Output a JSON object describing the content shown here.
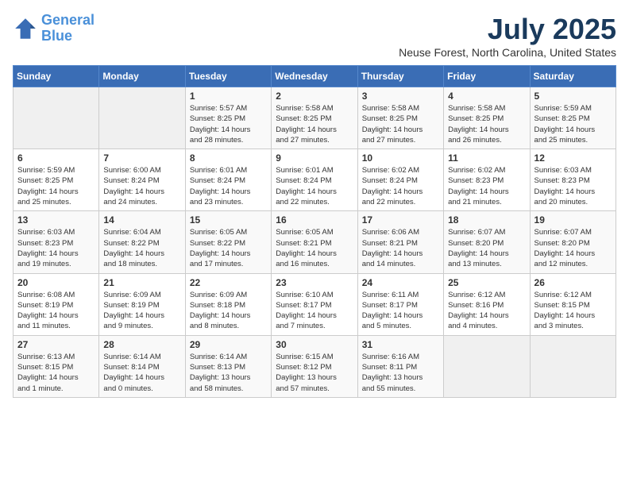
{
  "header": {
    "logo": {
      "line1": "General",
      "line2": "Blue"
    },
    "month": "July 2025",
    "location": "Neuse Forest, North Carolina, United States"
  },
  "weekdays": [
    "Sunday",
    "Monday",
    "Tuesday",
    "Wednesday",
    "Thursday",
    "Friday",
    "Saturday"
  ],
  "weeks": [
    [
      {
        "day": "",
        "info": ""
      },
      {
        "day": "",
        "info": ""
      },
      {
        "day": "1",
        "info": "Sunrise: 5:57 AM\nSunset: 8:25 PM\nDaylight: 14 hours\nand 28 minutes."
      },
      {
        "day": "2",
        "info": "Sunrise: 5:58 AM\nSunset: 8:25 PM\nDaylight: 14 hours\nand 27 minutes."
      },
      {
        "day": "3",
        "info": "Sunrise: 5:58 AM\nSunset: 8:25 PM\nDaylight: 14 hours\nand 27 minutes."
      },
      {
        "day": "4",
        "info": "Sunrise: 5:58 AM\nSunset: 8:25 PM\nDaylight: 14 hours\nand 26 minutes."
      },
      {
        "day": "5",
        "info": "Sunrise: 5:59 AM\nSunset: 8:25 PM\nDaylight: 14 hours\nand 25 minutes."
      }
    ],
    [
      {
        "day": "6",
        "info": "Sunrise: 5:59 AM\nSunset: 8:25 PM\nDaylight: 14 hours\nand 25 minutes."
      },
      {
        "day": "7",
        "info": "Sunrise: 6:00 AM\nSunset: 8:24 PM\nDaylight: 14 hours\nand 24 minutes."
      },
      {
        "day": "8",
        "info": "Sunrise: 6:01 AM\nSunset: 8:24 PM\nDaylight: 14 hours\nand 23 minutes."
      },
      {
        "day": "9",
        "info": "Sunrise: 6:01 AM\nSunset: 8:24 PM\nDaylight: 14 hours\nand 22 minutes."
      },
      {
        "day": "10",
        "info": "Sunrise: 6:02 AM\nSunset: 8:24 PM\nDaylight: 14 hours\nand 22 minutes."
      },
      {
        "day": "11",
        "info": "Sunrise: 6:02 AM\nSunset: 8:23 PM\nDaylight: 14 hours\nand 21 minutes."
      },
      {
        "day": "12",
        "info": "Sunrise: 6:03 AM\nSunset: 8:23 PM\nDaylight: 14 hours\nand 20 minutes."
      }
    ],
    [
      {
        "day": "13",
        "info": "Sunrise: 6:03 AM\nSunset: 8:23 PM\nDaylight: 14 hours\nand 19 minutes."
      },
      {
        "day": "14",
        "info": "Sunrise: 6:04 AM\nSunset: 8:22 PM\nDaylight: 14 hours\nand 18 minutes."
      },
      {
        "day": "15",
        "info": "Sunrise: 6:05 AM\nSunset: 8:22 PM\nDaylight: 14 hours\nand 17 minutes."
      },
      {
        "day": "16",
        "info": "Sunrise: 6:05 AM\nSunset: 8:21 PM\nDaylight: 14 hours\nand 16 minutes."
      },
      {
        "day": "17",
        "info": "Sunrise: 6:06 AM\nSunset: 8:21 PM\nDaylight: 14 hours\nand 14 minutes."
      },
      {
        "day": "18",
        "info": "Sunrise: 6:07 AM\nSunset: 8:20 PM\nDaylight: 14 hours\nand 13 minutes."
      },
      {
        "day": "19",
        "info": "Sunrise: 6:07 AM\nSunset: 8:20 PM\nDaylight: 14 hours\nand 12 minutes."
      }
    ],
    [
      {
        "day": "20",
        "info": "Sunrise: 6:08 AM\nSunset: 8:19 PM\nDaylight: 14 hours\nand 11 minutes."
      },
      {
        "day": "21",
        "info": "Sunrise: 6:09 AM\nSunset: 8:19 PM\nDaylight: 14 hours\nand 9 minutes."
      },
      {
        "day": "22",
        "info": "Sunrise: 6:09 AM\nSunset: 8:18 PM\nDaylight: 14 hours\nand 8 minutes."
      },
      {
        "day": "23",
        "info": "Sunrise: 6:10 AM\nSunset: 8:17 PM\nDaylight: 14 hours\nand 7 minutes."
      },
      {
        "day": "24",
        "info": "Sunrise: 6:11 AM\nSunset: 8:17 PM\nDaylight: 14 hours\nand 5 minutes."
      },
      {
        "day": "25",
        "info": "Sunrise: 6:12 AM\nSunset: 8:16 PM\nDaylight: 14 hours\nand 4 minutes."
      },
      {
        "day": "26",
        "info": "Sunrise: 6:12 AM\nSunset: 8:15 PM\nDaylight: 14 hours\nand 3 minutes."
      }
    ],
    [
      {
        "day": "27",
        "info": "Sunrise: 6:13 AM\nSunset: 8:15 PM\nDaylight: 14 hours\nand 1 minute."
      },
      {
        "day": "28",
        "info": "Sunrise: 6:14 AM\nSunset: 8:14 PM\nDaylight: 14 hours\nand 0 minutes."
      },
      {
        "day": "29",
        "info": "Sunrise: 6:14 AM\nSunset: 8:13 PM\nDaylight: 13 hours\nand 58 minutes."
      },
      {
        "day": "30",
        "info": "Sunrise: 6:15 AM\nSunset: 8:12 PM\nDaylight: 13 hours\nand 57 minutes."
      },
      {
        "day": "31",
        "info": "Sunrise: 6:16 AM\nSunset: 8:11 PM\nDaylight: 13 hours\nand 55 minutes."
      },
      {
        "day": "",
        "info": ""
      },
      {
        "day": "",
        "info": ""
      }
    ]
  ]
}
